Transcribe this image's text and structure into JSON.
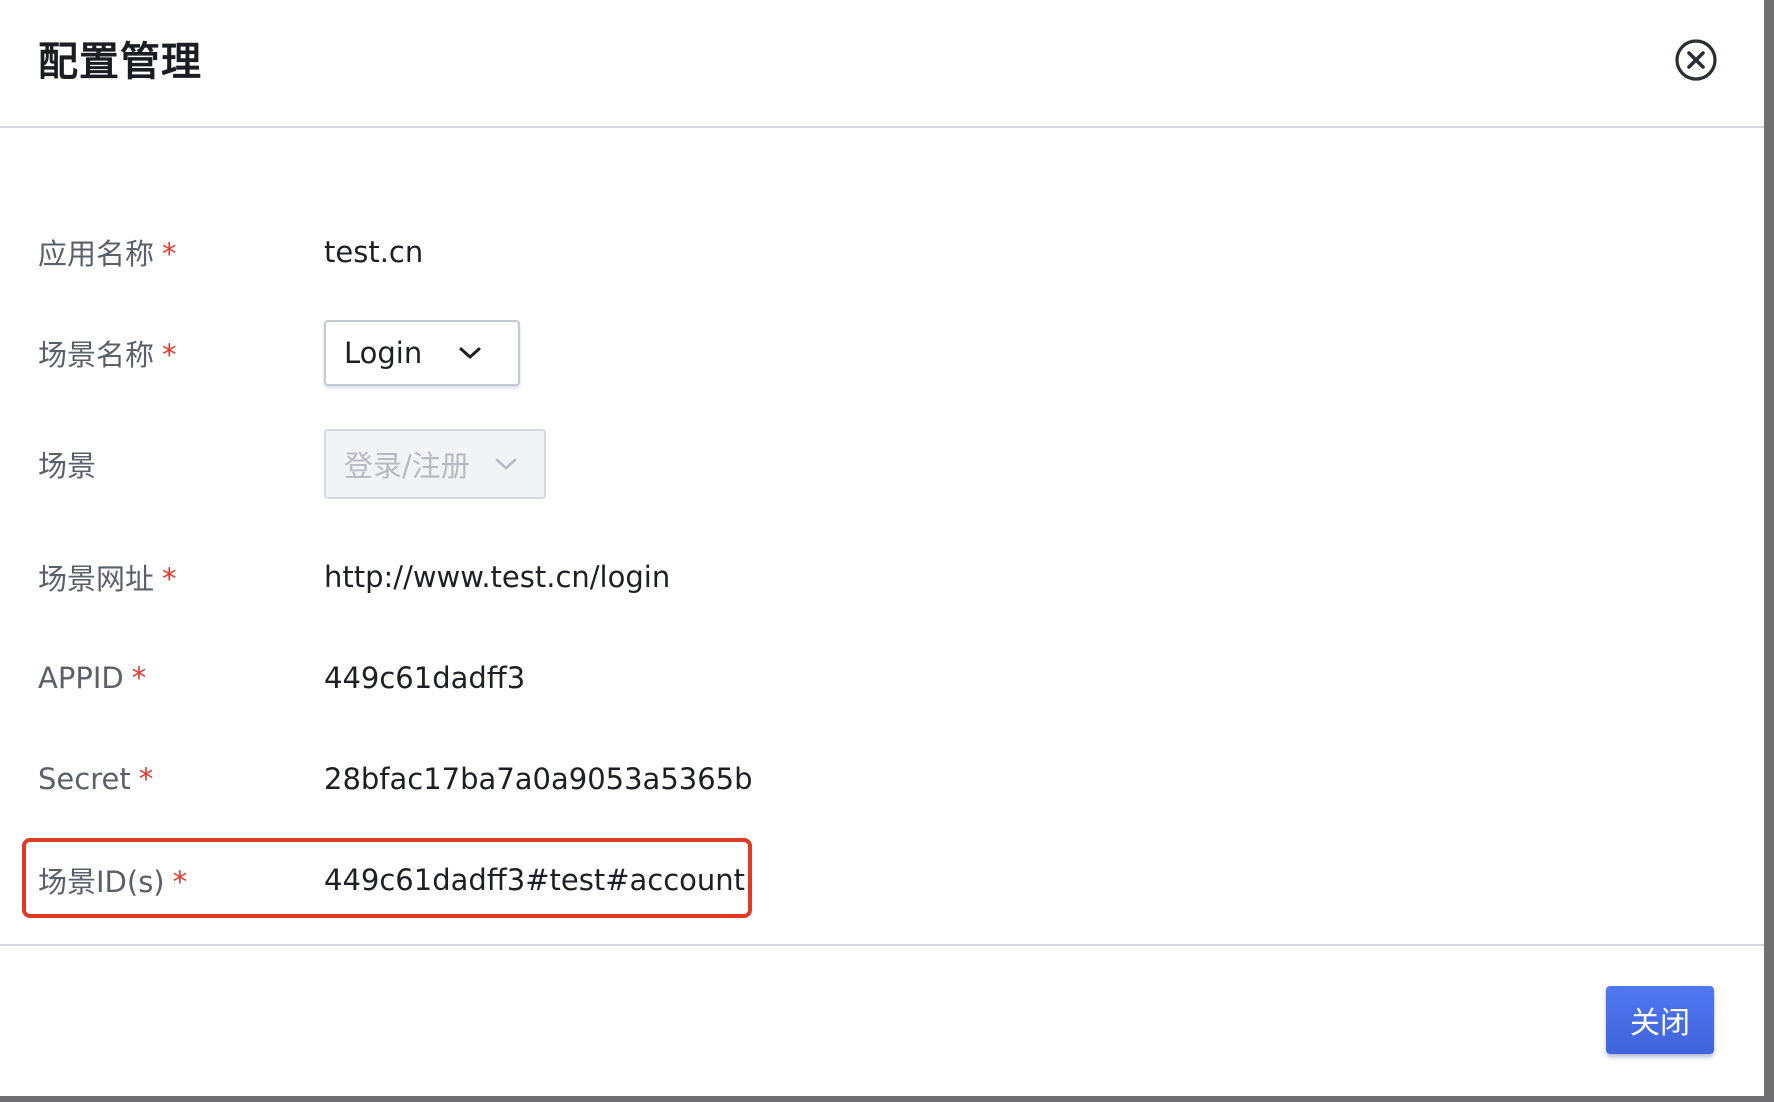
{
  "dialog": {
    "title": "配置管理",
    "close_icon": "close-circle-icon"
  },
  "form": {
    "app_name": {
      "label": "应用名称",
      "required": "*",
      "value": "test.cn"
    },
    "scene_name": {
      "label": "场景名称",
      "required": "*",
      "selected": "Login",
      "icon": "chevron-down-icon"
    },
    "scene": {
      "label": "场景",
      "selected": "登录/注册",
      "disabled": true,
      "icon": "chevron-down-icon"
    },
    "scene_url": {
      "label": "场景网址",
      "required": "*",
      "value": "http://www.test.cn/login"
    },
    "appid": {
      "label": "APPID",
      "required": "*",
      "value": "449c61dadff3"
    },
    "secret": {
      "label": "Secret",
      "required": "*",
      "value": "28bfac17ba7a0a9053a5365b"
    },
    "scene_ids": {
      "label": "场景ID(s)",
      "required": "*",
      "value": "449c61dadff3#test#account",
      "highlighted": true
    }
  },
  "footer": {
    "close_label": "关闭"
  },
  "colors": {
    "primary": "#4169e1",
    "required": "#e5382b",
    "highlight": "#e03a24",
    "label": "#5a5f6a"
  }
}
